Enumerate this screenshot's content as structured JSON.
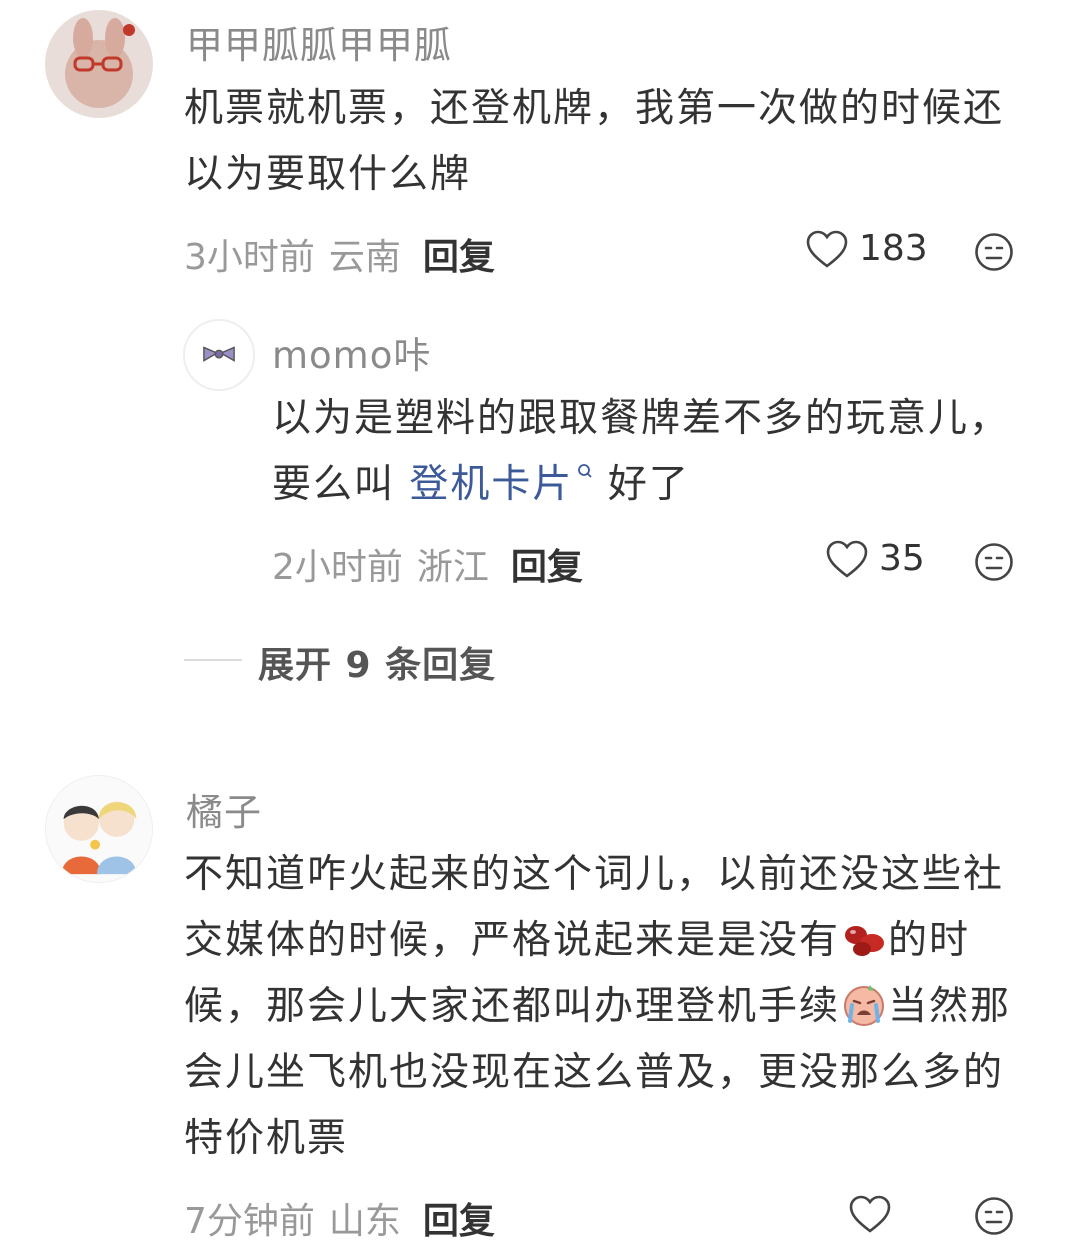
{
  "comments": [
    {
      "username": "甲甲胍胍甲甲胍",
      "lines": [
        "机票就机票，还登机牌，我第一次做的时候还",
        "以为要取什么牌"
      ],
      "time": "3小时前",
      "location": "云南",
      "reply_label": "回复",
      "likes": "183"
    },
    {
      "username": "橘子",
      "lines": [
        "不知道咋火起来的这个词儿，以前还没这些社",
        "交媒体的时候，严格说起来是是没有",
        "的时",
        "候，那会儿大家还都叫办理登机手续",
        "当然那",
        "会儿坐飞机也没现在这么普及，更没那么多的",
        "特价机票"
      ],
      "time": "7分钟前",
      "location": "山东",
      "reply_label": "回复",
      "likes": ""
    }
  ],
  "reply": {
    "username": "momo咔",
    "line1": "以为是塑料的跟取餐牌差不多的玩意儿，",
    "line2_prefix": "要么叫 ",
    "line2_link": "登机卡片",
    "line2_suffix": " 好了",
    "time": "2小时前",
    "location": "浙江",
    "reply_label": "回复",
    "likes": "35"
  },
  "expand_label": "展开 9 条回复",
  "icons": {
    "like": "heart-outline-icon",
    "dislike": "neutral-face-icon",
    "link": "search-icon",
    "emoji1": "red-beans-emoji",
    "emoji2": "crying-face-emoji"
  }
}
